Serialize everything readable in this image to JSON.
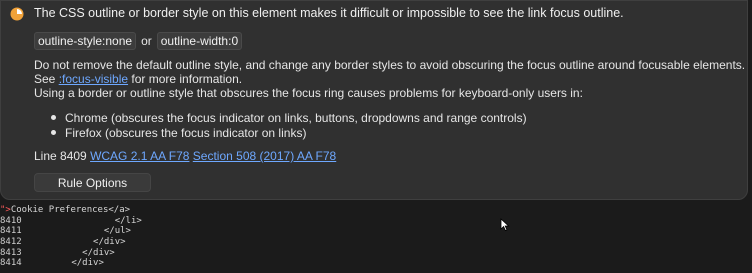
{
  "issue": {
    "icon": "warning-icon",
    "accent_color": "#f0a23a",
    "heading": "The CSS outline or border style on this element makes it difficult or impossible to see the link focus outline.",
    "code_chip_1": "outline-style:none",
    "or_text": "or",
    "code_chip_2": "outline-width:0",
    "advice_line_1": "Do not remove the default outline style, and change any border styles to avoid obscuring the focus outline around focusable elements.",
    "see_prefix": "See ",
    "see_link": ":focus-visible",
    "see_suffix": " for more information.",
    "problem_line": "Using a border or outline style that obscures the focus ring causes problems for keyboard-only users in:",
    "bullets": [
      "Chrome (obscures the focus indicator on links, buttons, dropdowns and range controls)",
      "Firefox (obscures the focus indicator on links)"
    ],
    "line_prefix": "Line 8409",
    "link_wcag": "WCAG 2.1 AA F78",
    "link_section508": "Section 508 (2017) AA F78",
    "rule_options_label": "Rule Options"
  },
  "code": {
    "first_line_marker": "\">",
    "first_line_text": "Cookie Preferences</a>",
    "lines": [
      {
        "num": "8410",
        "text": "                </li>"
      },
      {
        "num": "8411",
        "text": "              </ul>"
      },
      {
        "num": "8412",
        "text": "            </div>"
      },
      {
        "num": "8413",
        "text": "          </div>"
      },
      {
        "num": "8414",
        "text": "        </div>"
      }
    ]
  }
}
